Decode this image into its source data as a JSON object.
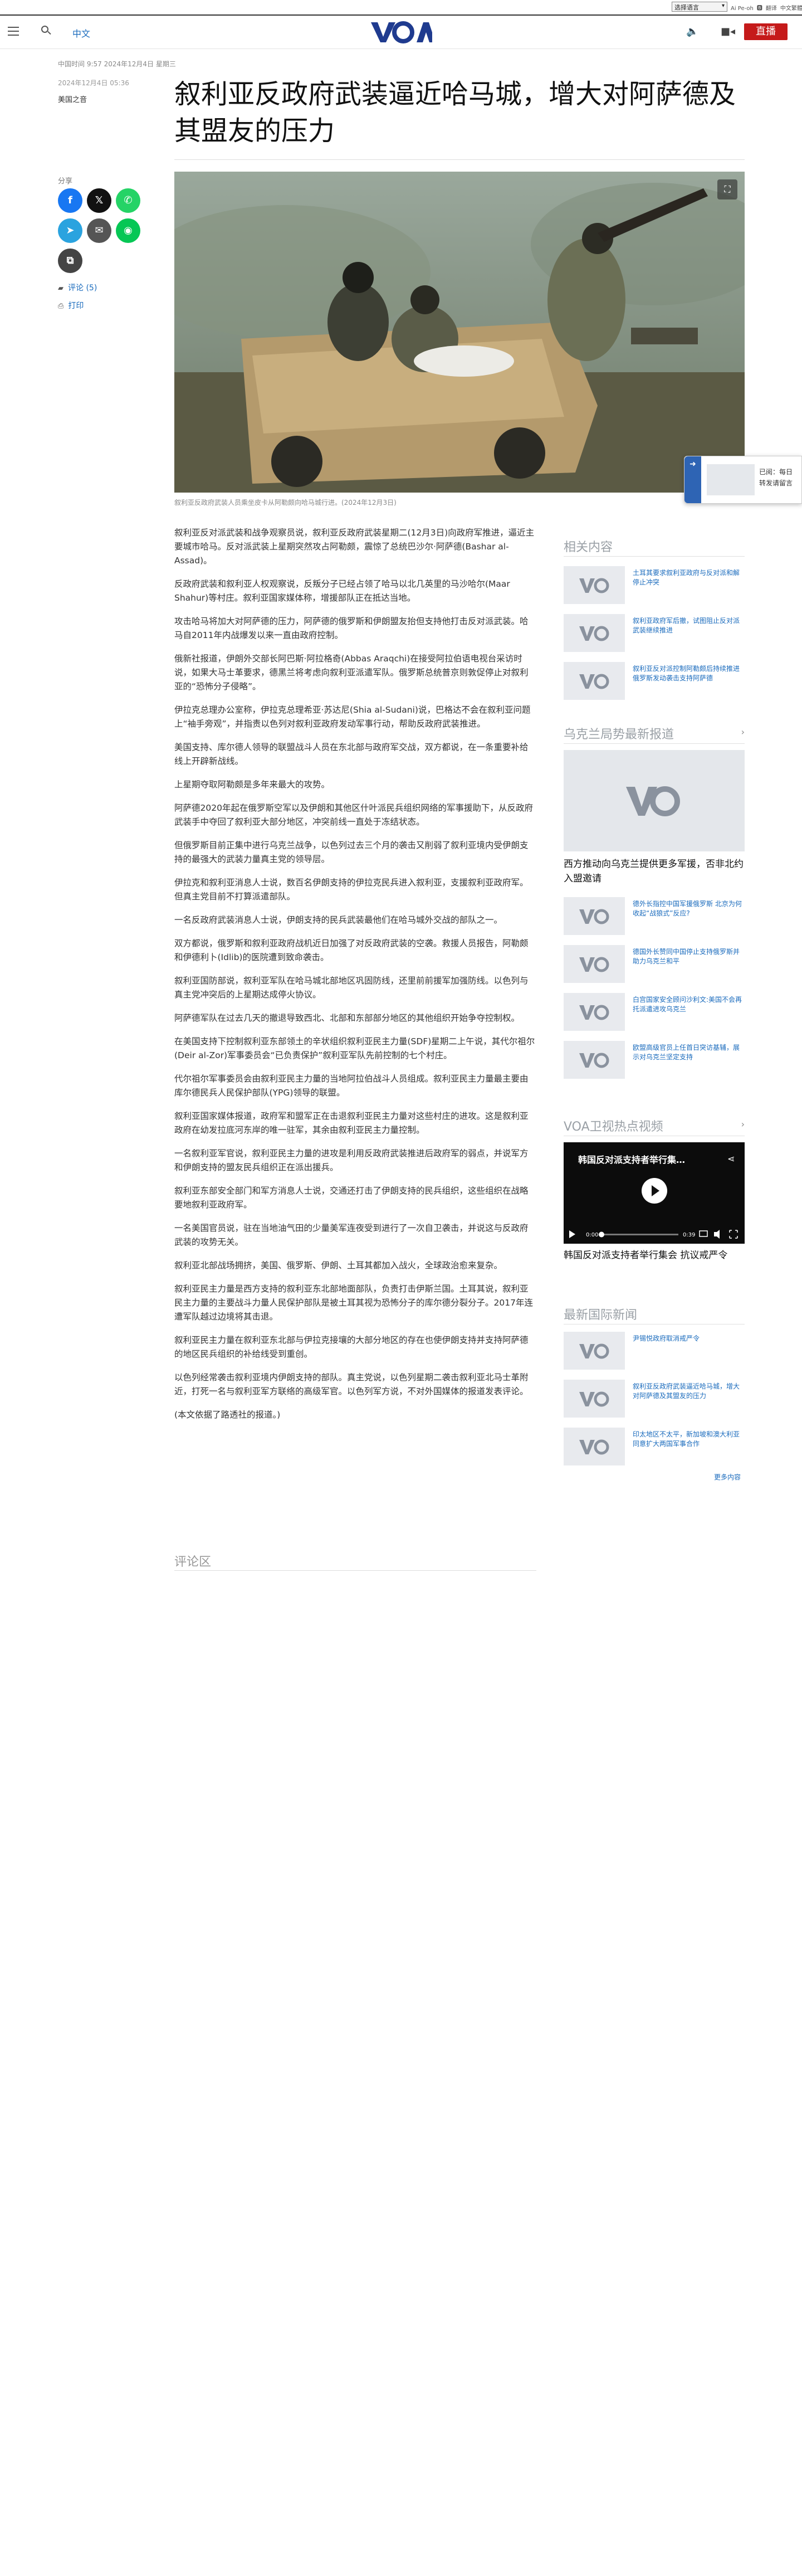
{
  "util": {
    "lang_select": "选择语言",
    "links": [
      "Ai Pe-oh",
      "🅱",
      "翻译",
      "中文繁體",
      "繁體版"
    ]
  },
  "header": {
    "lang_link": "中文",
    "live_label": "直播",
    "audio_icon": "speaker-icon",
    "video_icon": "video-icon"
  },
  "article": {
    "meta_line": "中国时间 9:57 2024年12月4日 星期三",
    "date": "2024年12月4日 05:36",
    "author": "美国之音",
    "title": "叙利亚反政府武装逼近哈马城，增大对阿萨德及其盟友的压力",
    "share_label": "分享",
    "comments_link": "评论 (5)",
    "print_link": "打印",
    "caption": "叙利亚反政府武装人员乘坐皮卡从阿勒颇向哈马城行进。(2024年12月3日)",
    "paragraphs": [
      "叙利亚反对派武装和战争观察员说，叙利亚反政府武装星期二(12月3日)向政府军推进，逼近主要城市哈马。反对派武装上星期突然攻占阿勒颇，震惊了总统巴沙尔·阿萨德(Bashar al-Assad)。",
      "反政府武装和叙利亚人权观察说，反叛分子已经占领了哈马以北几英里的马沙哈尔(Maar Shahur)等村庄。叙利亚国家媒体称，增援部队正在抵达当地。",
      "攻击哈马将加大对阿萨德的压力，阿萨德的俄罗斯和伊朗盟友抬但支持他打击反对派武装。哈马自2011年内战爆发以来一直由政府控制。",
      "俄新社报道，伊朗外交部长阿巴斯·阿拉格奇(Abbas Araqchi)在接受阿拉伯语电视台采访时说，如果大马士革要求，德黑兰将考虑向叙利亚派遣军队。俄罗斯总统普京则敦促停止对叙利亚的“恐怖分子侵略”。",
      "伊拉克总理办公室称，伊拉克总理希亚·苏达尼(Shia al-Sudani)说，巴格达不会在叙利亚问题上“袖手旁观”，并指责以色列对叙利亚政府发动军事行动，帮助反政府武装推进。",
      "美国支持、库尔德人领导的联盟战斗人员在东北部与政府军交战，双方都说，在一条重要补给线上开辟新战线。",
      "上星期夺取阿勒颇是多年来最大的攻势。",
      "阿萨德2020年起在俄罗斯空军以及伊朗和其他区什叶派民兵组织网络的军事援助下，从反政府武装手中夺回了叙利亚大部分地区，冲突前线一直处于冻结状态。",
      "但俄罗斯目前正集中进行乌克兰战争，以色列过去三个月的袭击又削弱了叙利亚境内受伊朗支持的最强大的武装力量真主党的领导层。",
      "伊拉克和叙利亚消息人士说，数百名伊朗支持的伊拉克民兵进入叙利亚，支援叙利亚政府军。但真主党目前不打算派遣部队。",
      "一名反政府武装消息人士说，伊朗支持的民兵武装最他们在哈马城外交战的部队之一。",
      "双方都说，俄罗斯和叙利亚政府战机近日加强了对反政府武装的空袭。救援人员报告，阿勒颇和伊德利卜(Idlib)的医院遭到致命袭击。",
      "叙利亚国防部说，叙利亚军队在哈马城北部地区巩固防线，还里前前援军加强防线。以色列与真主党冲突后的上星期达成停火协议。",
      "阿萨德军队在过去几天的撤退导致西北、北部和东部部分地区的其他组织开始争夺控制权。",
      "在美国支持下控制叙利亚东部领土的辛状组织叙利亚民主力量(SDF)星期二上午说，其代尔祖尔(Deir al-Zor)军事委员会“已负责保护”叙利亚军队先前控制的七个村庄。",
      "代尔祖尔军事委员会由叙利亚民主力量的当地阿拉伯战斗人员组成。叙利亚民主力量最主要由库尔德民兵人民保护部队(YPG)领导的联盟。",
      "叙利亚国家媒体报道，政府军和盟军正在击退叙利亚民主力量对这些村庄的进攻。这是叙利亚政府在幼发拉底河东岸的唯一驻军，其余由叙利亚民主力量控制。",
      "一名叙利亚军官说，叙利亚民主力量的进攻是利用反政府武装推进后政府军的弱点，并说军方和伊朗支持的盟友民兵组织正在派出援兵。",
      "叙利亚东部安全部门和军方消息人士说，交通还打击了伊朗支持的民兵组织，这些组织在战略要地叙利亚政府军。",
      "一名美国官员说，驻在当地油气田的少量美军连夜受到进行了一次自卫袭击，并说这与反政府武装的攻势无关。",
      "叙利亚北部战场拥挤，美国、俄罗斯、伊朗、土耳其都加入战火，全球政治愈来复杂。",
      "叙利亚民主力量是西方支持的叙利亚东北部地面部队，负责打击伊斯兰国。土耳其说，叙利亚民主力量的主要战斗力量人民保护部队是被土耳其视为恐怖分子的库尔德分裂分子。2017年连遭军队越过边境将其击退。",
      "叙利亚民主力量在叙利亚东北部与伊拉克接壤的大部分地区的存在也使伊朗支持并支持阿萨德的地区民兵组织的补给线受到重创。",
      "以色列经常袭击叙利亚境内伊朗支持的部队。真主党说，以色列星期二袭击叙利亚北马士革附近，打死一名与叙利亚军方联络的高级军官。以色列军方说，不对外国媒体的报道发表评论。",
      "(本文依据了路透社的报道。)"
    ],
    "comments_title": "评论区"
  },
  "rail": {
    "related_title": "相关内容",
    "related": [
      "土耳其要求叙利亚政府与反对派和解停止冲突",
      "叙利亚政府军后撤，试图阻止反对派武装继续推进",
      "叙利亚反对派控制阿勒颇后持续推进 俄罗斯发动袭击支持阿萨德"
    ],
    "ukraine_title": "乌克兰局势最新报道",
    "ukraine_lead": "西方推动向乌克兰提供更多军援，否非北约入盟邀请",
    "ukraine": [
      "德外长指控中国军援俄罗斯 北京为何收起“战狼式”反应?",
      "德国外长赞同中国停止支持俄罗斯并助力乌克兰和平",
      "白宫国家安全顾问沙利文:美国不会再托派遣进攻乌克兰",
      "欧盟高级官员上任首日突访基辅，展示对乌克兰坚定支持"
    ],
    "video_title": "VOA卫视热点视频",
    "video_overlay": "韩国反对派支持者举行集…",
    "video_time": "0:00",
    "video_duration": "0:39",
    "video_caption": "韩国反对派支持者举行集会 抗议戒严令",
    "intl_title": "最新国际新闻",
    "intl": [
      "尹锡悦政府取消戒严令",
      "叙利亚反政府武装逼近哈马城，增大对阿萨德及其盟友的压力",
      "印太地区不太平，新加坡和澳大利亚同意扩大两国军事合作"
    ],
    "more_label": "更多内容"
  },
  "float": {
    "text1": "已阅：每日",
    "text2": "转发请留言"
  }
}
